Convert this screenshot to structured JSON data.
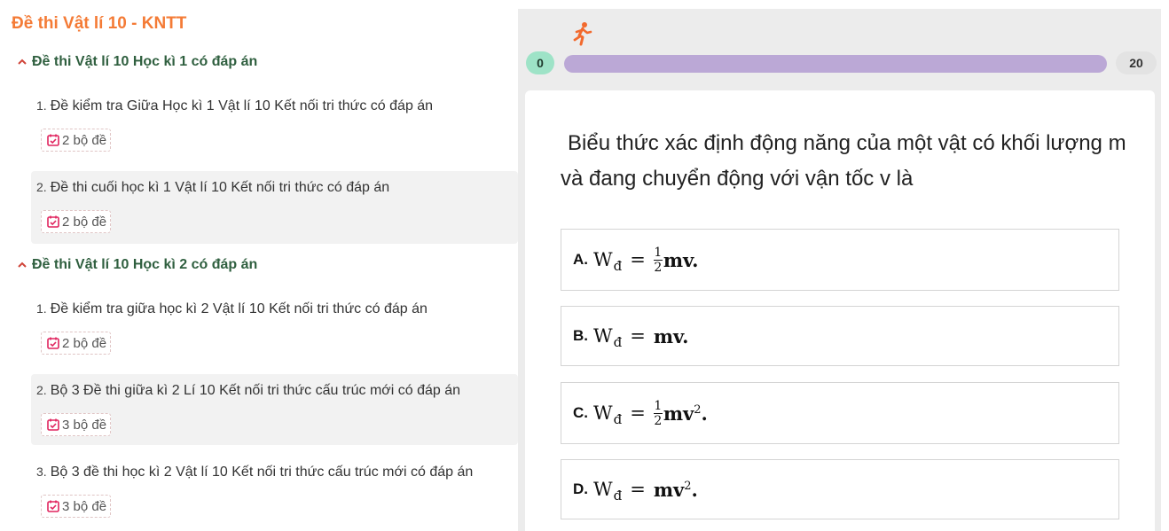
{
  "sidebar": {
    "title": "Đề thi Vật lí 10 - KNTT",
    "sections": [
      {
        "title": "Đề thi Vật lí 10 Học kì 1 có đáp án",
        "items": [
          {
            "num": "1.",
            "label": "Đề kiểm tra Giữa Học kì 1 Vật lí 10 Kết nối tri thức có đáp án",
            "badge": "2 bộ đề"
          },
          {
            "num": "2.",
            "label": "Đề thi cuối học kì 1 Vật lí 10 Kết nối tri thức có đáp án",
            "badge": "2 bộ đề"
          }
        ]
      },
      {
        "title": "Đề thi Vật lí 10 Học kì 2 có đáp án",
        "items": [
          {
            "num": "1.",
            "label": "Đề kiểm tra giữa học kì 2 Vật lí 10 Kết nối tri thức có đáp án",
            "badge": "2 bộ đề"
          },
          {
            "num": "2.",
            "label": "Bộ 3 Đề thi giữa kì 2 Lí 10 Kết nối tri thức cấu trúc mới có đáp án",
            "badge": "3 bộ đề"
          },
          {
            "num": "3.",
            "label": "Bộ 3 đề thi học kì 2 Vật lí 10 Kết nối tri thức cấu trúc mới có đáp án",
            "badge": "3 bộ đề"
          }
        ]
      }
    ]
  },
  "quiz": {
    "progress": {
      "start": "0",
      "end": "20",
      "fraction": 0
    },
    "question": "Biểu thức xác định động năng của một vật có khối lượng m và đang chuyển động với vận tốc v là",
    "options": [
      {
        "letter": "A.",
        "lhs": "W",
        "sub": "đ",
        "eq": "=",
        "frac_num": "1",
        "frac_den": "2",
        "rhs": "mv.",
        "sup": ""
      },
      {
        "letter": "B.",
        "lhs": "W",
        "sub": "đ",
        "eq": "=",
        "frac_num": "",
        "frac_den": "",
        "rhs": "mv.",
        "sup": ""
      },
      {
        "letter": "C.",
        "lhs": "W",
        "sub": "đ",
        "eq": "=",
        "frac_num": "1",
        "frac_den": "2",
        "rhs": "mv",
        "sup": "2",
        "tail": "."
      },
      {
        "letter": "D.",
        "lhs": "W",
        "sub": "đ",
        "eq": "=",
        "frac_num": "",
        "frac_den": "",
        "rhs": "mv",
        "sup": "2",
        "tail": "."
      }
    ]
  },
  "colors": {
    "title_orange": "#f47b36",
    "section_green": "#2f5f3f",
    "progress_bar": "#bba8d6",
    "count_pill": "#9ee3c7",
    "badge_icon": "#e0245e"
  },
  "icons": {
    "section_caret": "chevron-up-icon",
    "badge": "calendar-check-icon",
    "runner": "running-person-icon"
  }
}
